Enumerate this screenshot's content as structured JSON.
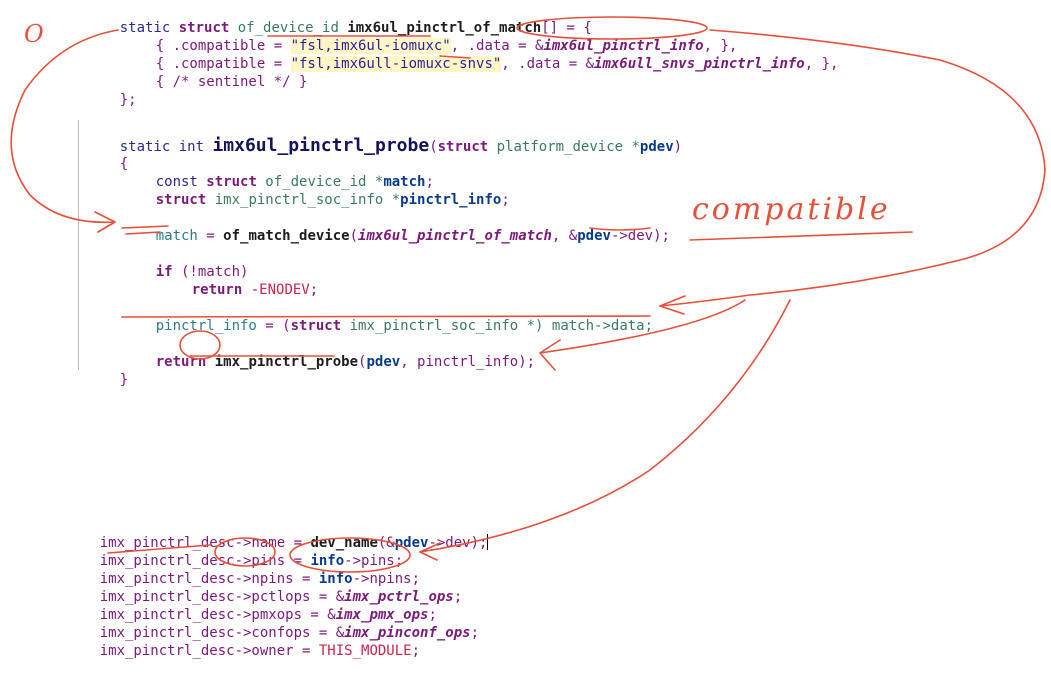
{
  "code": {
    "l1": {
      "a": "static ",
      "b": "struct",
      "c": " of_device_id ",
      "d": "imx6ul_pinctrl_of_match",
      "e": "[] = {"
    },
    "l2": {
      "a": "{ .compatible = ",
      "b": "\"fsl,imx6ul-iomuxc\"",
      "c": ", .data = &",
      "d": "imx6ul_pinctrl_info",
      "e": ", },"
    },
    "l3": {
      "a": "{ .compatible = ",
      "b": "\"fsl,imx6ull-iomuxc-snvs\"",
      "c": ", .data = &",
      "d": "imx6ull_snvs_pinctrl_info",
      "e": ", },"
    },
    "l4": {
      "a": "{ /* sentinel */ }"
    },
    "l5": {
      "a": "};"
    },
    "l6": {
      "a": "static int ",
      "b": "imx6ul_pinctrl_probe",
      "c": "(",
      "d": "struct",
      "e": " platform_device *",
      "f": "pdev",
      "g": ")"
    },
    "l7": {
      "a": "{"
    },
    "l8": {
      "a": "const ",
      "b": "struct",
      "c": " of_device_id *",
      "d": "match",
      "e": ";"
    },
    "l9": {
      "a": "struct",
      "b": " imx_pinctrl_soc_info *",
      "c": "pinctrl_info",
      "d": ";"
    },
    "l10": {
      "a": "match",
      "b": " = ",
      "c": "of_match_device",
      "d": "(",
      "e": "imx6ul_pinctrl_of_match",
      "f": ", &",
      "g": "pdev",
      "h": "->dev);"
    },
    "l11": {
      "a": "if",
      "b": " (!match)"
    },
    "l12": {
      "a": "return",
      "b": " -",
      "c": "ENODEV",
      "d": ";"
    },
    "l13": {
      "a": "pinctrl_info",
      "b": " = (",
      "c": "struct",
      "d": " imx_pinctrl_soc_info *) match->data;"
    },
    "l14": {
      "a": "return",
      "b": " ",
      "c": "imx_pinctrl_probe",
      "d": "(",
      "e": "pdev",
      "f": ", pinctrl_info);"
    },
    "l15": {
      "a": "}"
    }
  },
  "code2": {
    "m1": {
      "a": "imx_pinctrl_desc->name = ",
      "b": "dev_name",
      "c": "(&",
      "d": "pdev",
      "e": "->dev);"
    },
    "m2": {
      "a": "imx_pinctrl_desc->pins = ",
      "b": "info",
      "c": "->pins;"
    },
    "m3": {
      "a": "imx_pinctrl_desc->npins = ",
      "b": "info",
      "c": "->npins;"
    },
    "m4": {
      "a": "imx_pinctrl_desc->pctlops = &",
      "b": "imx_pctrl_ops",
      "c": ";"
    },
    "m5": {
      "a": "imx_pinctrl_desc->pmxops = &",
      "b": "imx_pmx_ops",
      "c": ";"
    },
    "m6": {
      "a": "imx_pinctrl_desc->confops = &",
      "b": "imx_pinconf_ops",
      "c": ";"
    },
    "m7": {
      "a": "imx_pinctrl_desc->owner = ",
      "b": "THIS_MODULE",
      "c": ";"
    }
  },
  "annotations": {
    "handwriting": "compatible",
    "mark_o": "O"
  },
  "colors": {
    "ink": "#e6503a"
  }
}
